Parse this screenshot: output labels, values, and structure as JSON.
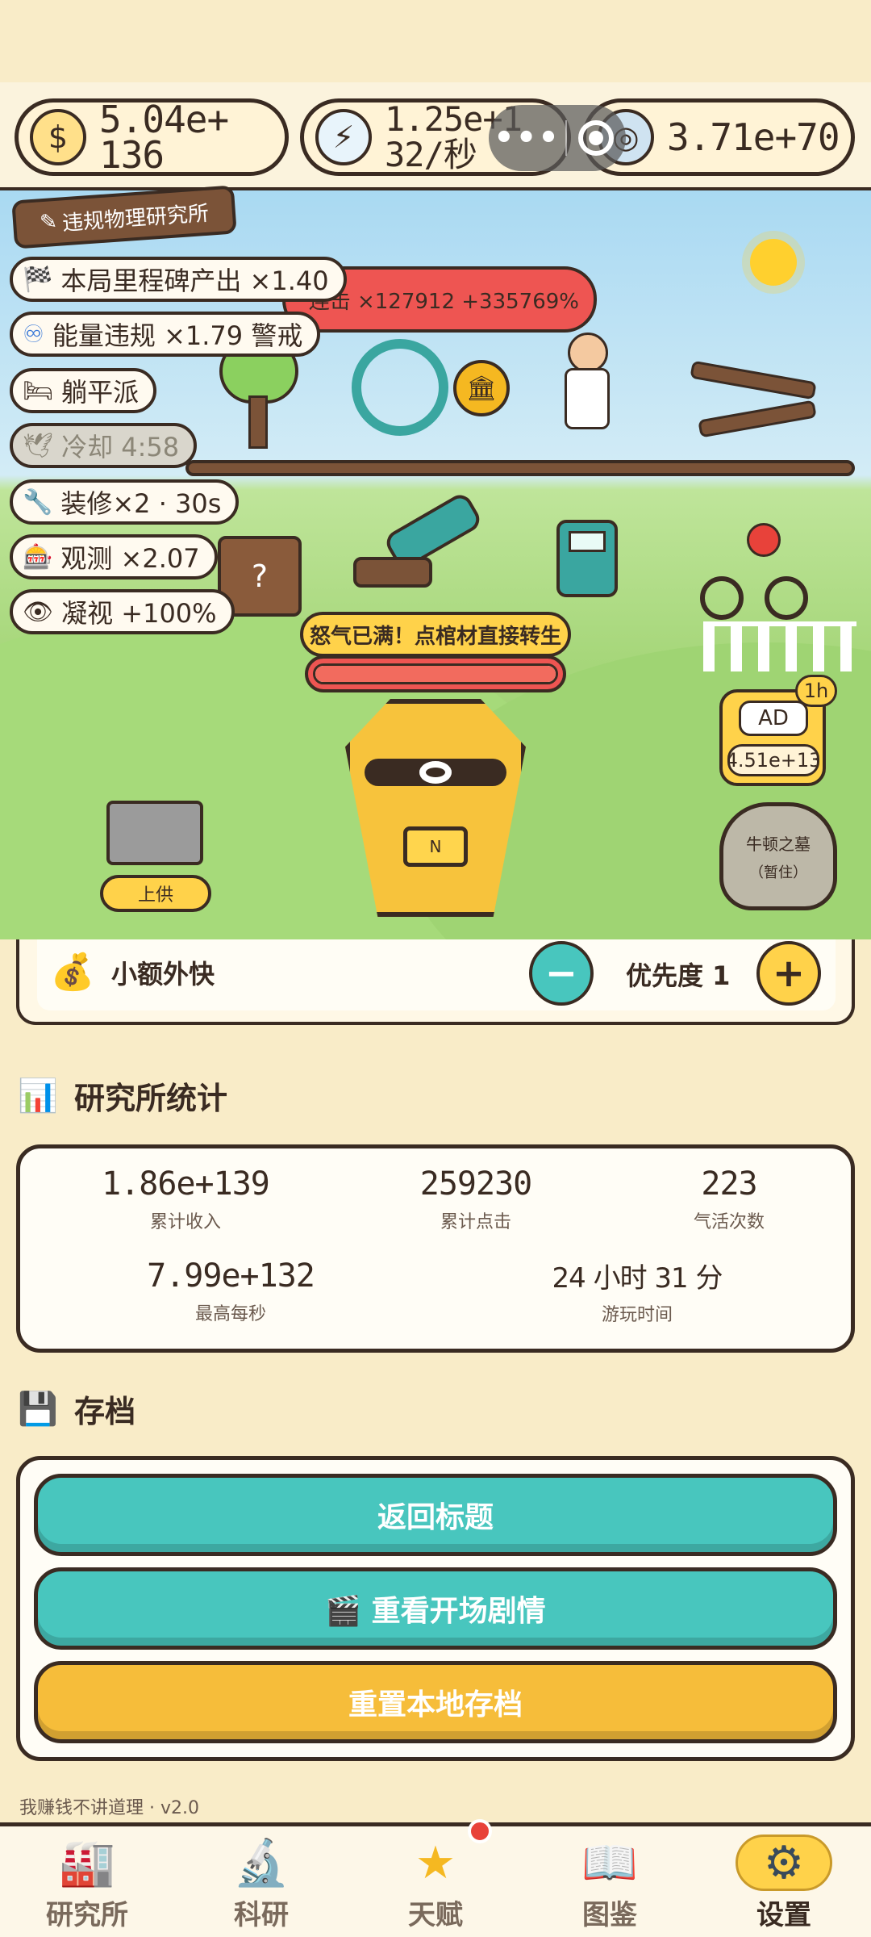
{
  "resources": {
    "money": {
      "icon": "money-bag-icon",
      "value_line1": "5.04e+",
      "value_line2": "136"
    },
    "energy": {
      "icon": "lightning-icon",
      "value_line1": "1.25e+1",
      "value_line2": "32/秒"
    },
    "ring": {
      "icon": "ring-icon",
      "value": "3.71e+70"
    }
  },
  "scene": {
    "lab_sign": "违规物理研究所",
    "red_banner": "连击 ×127912 +335769%",
    "buffs": [
      {
        "icon": "🏁",
        "text": "本局里程碑产出 ×1.40"
      },
      {
        "icon": "♾",
        "text": "能量违规 ×1.79 警戒"
      },
      {
        "icon": "🛏",
        "text": "躺平派"
      },
      {
        "icon": "🕊",
        "text": "冷却 4:58"
      },
      {
        "icon": "🔧",
        "text": "装修×2 · 30s"
      },
      {
        "icon": "🎰",
        "text": "观测 ×2.07"
      },
      {
        "icon": "👁",
        "text": "凝视 +100%"
      }
    ],
    "rage_label": "怒气已满！点棺材直接转生",
    "rage_progress": 1.0,
    "coffin_plate": "N",
    "offer_button": "上供",
    "ad": {
      "label": "AD",
      "value": "4.51e+13",
      "badge": "1h"
    },
    "tomb": {
      "title": "牛顿之墓",
      "subtitle": "（暂住）"
    }
  },
  "task": {
    "icon": "money-bag-icon",
    "name": "小额外快",
    "minus": "−",
    "priority_label": "优先度 1",
    "plus": "+"
  },
  "stats": {
    "title": "研究所统计",
    "items": [
      {
        "value": "1.86e+139",
        "label": "累计收入"
      },
      {
        "value": "259230",
        "label": "累计点击"
      },
      {
        "value": "223",
        "label": "气活次数"
      },
      {
        "value": "7.99e+132",
        "label": "最高每秒"
      },
      {
        "value": "24 小时 31 分",
        "label": "游玩时间"
      }
    ]
  },
  "save": {
    "title": "存档",
    "buttons": {
      "back_title": "返回标题",
      "replay_intro": "🎬 重看开场剧情",
      "reset_save": "重置本地存档"
    }
  },
  "footer": "我赚钱不讲道理 · v2.0",
  "nav": [
    {
      "label": "研究所",
      "icon": "factory-icon"
    },
    {
      "label": "科研",
      "icon": "microscope-icon"
    },
    {
      "label": "天赋",
      "icon": "star-icon"
    },
    {
      "label": "图鉴",
      "icon": "book-icon"
    },
    {
      "label": "设置",
      "icon": "gear-icon"
    }
  ],
  "colors": {
    "teal": "#48c6be",
    "gold": "#f6bd3a",
    "red": "#ee5552",
    "outline": "#3a2b22",
    "bg": "#f9ecc8"
  }
}
